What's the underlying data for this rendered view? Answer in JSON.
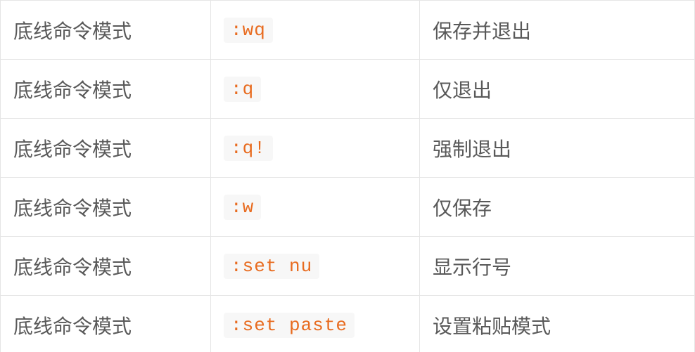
{
  "rows": [
    {
      "mode": "底线命令模式",
      "command": ":wq",
      "description": "保存并退出"
    },
    {
      "mode": "底线命令模式",
      "command": ":q",
      "description": "仅退出"
    },
    {
      "mode": "底线命令模式",
      "command": ":q!",
      "description": "强制退出"
    },
    {
      "mode": "底线命令模式",
      "command": ":w",
      "description": "仅保存"
    },
    {
      "mode": "底线命令模式",
      "command": ":set nu",
      "description": "显示行号"
    },
    {
      "mode": "底线命令模式",
      "command": ":set paste",
      "description": "设置粘贴模式"
    }
  ]
}
